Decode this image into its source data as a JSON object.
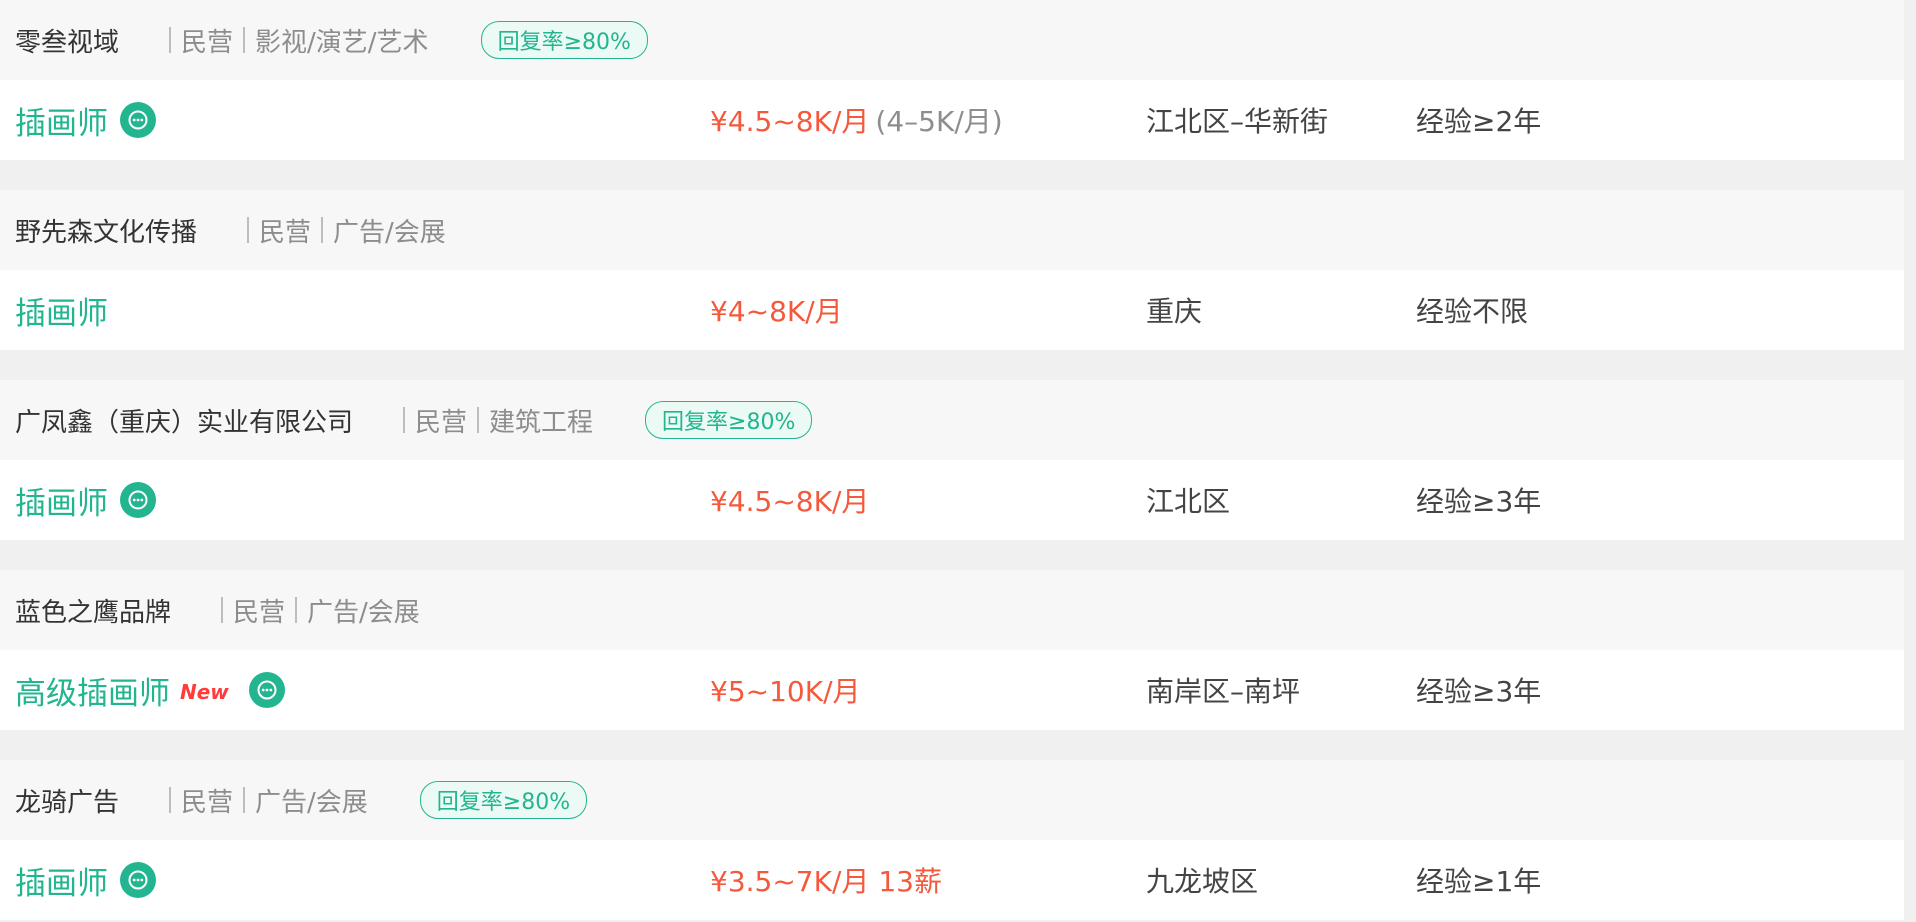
{
  "listings": [
    {
      "company": "零叁视域",
      "tags": [
        "民营",
        "影视/演艺/艺术"
      ],
      "reply_badge": "回复率≥80%",
      "job_title": "插画师",
      "is_new": false,
      "new_label": "",
      "chat_icon": "chat-bubble-icon",
      "salary": "¥4.5~8K/月",
      "salary_extra": "(4–5K/月)",
      "location": "江北区–华新街",
      "experience": "经验≥2年"
    },
    {
      "company": "野先森文化传播",
      "tags": [
        "民营",
        "广告/会展"
      ],
      "reply_badge": "",
      "job_title": "插画师",
      "is_new": false,
      "new_label": "",
      "chat_icon": "",
      "salary": "¥4~8K/月",
      "salary_extra": "",
      "location": "重庆",
      "experience": "经验不限"
    },
    {
      "company": "广凤鑫（重庆）实业有限公司",
      "tags": [
        "民营",
        "建筑工程"
      ],
      "reply_badge": "回复率≥80%",
      "job_title": "插画师",
      "is_new": false,
      "new_label": "",
      "chat_icon": "chat-bubble-icon",
      "salary": "¥4.5~8K/月",
      "salary_extra": "",
      "location": "江北区",
      "experience": "经验≥3年"
    },
    {
      "company": "蓝色之鹰品牌",
      "tags": [
        "民营",
        "广告/会展"
      ],
      "reply_badge": "",
      "job_title": "高级插画师",
      "is_new": true,
      "new_label": "New",
      "chat_icon": "chat-bubble-icon",
      "salary": "¥5~10K/月",
      "salary_extra": "",
      "location": "南岸区–南坪",
      "experience": "经验≥3年"
    },
    {
      "company": "龙骑广告",
      "tags": [
        "民营",
        "广告/会展"
      ],
      "reply_badge": "回复率≥80%",
      "job_title": "插画师",
      "is_new": false,
      "new_label": "",
      "chat_icon": "chat-bubble-icon",
      "salary": "¥3.5~7K/月 13薪",
      "salary_extra": "",
      "location": "九龙坡区",
      "experience": "经验≥1年"
    }
  ],
  "colors": {
    "accent_green": "#22b58f",
    "salary_red": "#f5583a",
    "new_red": "#ff3b3b",
    "muted_gray": "#8d8d8d"
  }
}
